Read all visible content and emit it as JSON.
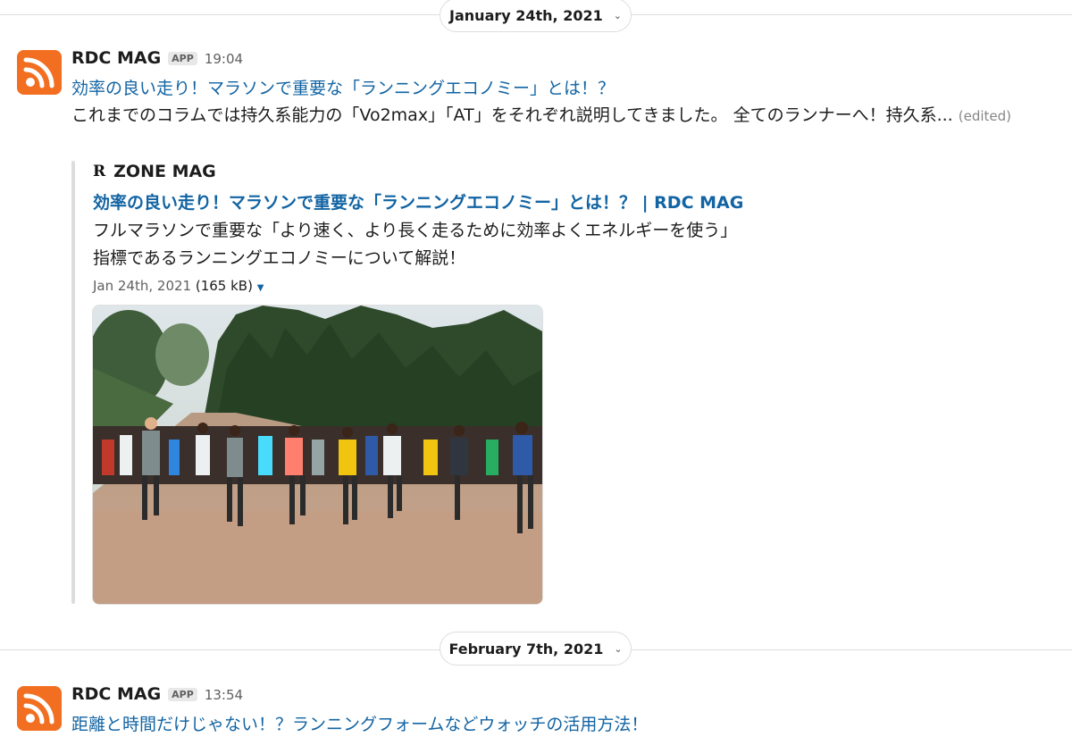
{
  "dividers": [
    {
      "date_label": "January 24th, 2021"
    },
    {
      "date_label": "February 7th, 2021"
    }
  ],
  "messages": [
    {
      "sender": "RDC MAG",
      "badge": "APP",
      "time": "19:04",
      "link": "効率の良い走り！マラソンで重要な「ランニングエコノミー」とは！？",
      "body": "これまでのコラムでは持久系能力の「Vo2max」「AT」をそれぞれ説明してきました。 全てのランナーへ！持久系...",
      "edited": "(edited)",
      "attachment": {
        "source_name": "ZONE MAG",
        "title": "効率の良い走り！マラソンで重要な「ランニングエコノミー」とは！？ | RDC MAG",
        "desc_line1": "フルマラソンで重要な「より速く、より長く走るために効率よくエネルギーを使う」",
        "desc_line2": "指標であるランニングエコノミーについて解説！",
        "date": "Jan 24th, 2021",
        "size": "(165 kB)"
      }
    },
    {
      "sender": "RDC MAG",
      "badge": "APP",
      "time": "13:54",
      "link": "距離と時間だけじゃない！？ランニングフォームなどウォッチの活用方法！"
    }
  ],
  "colors": {
    "link": "#1264a3",
    "avatar": "#f26f21",
    "text": "#1d1c1d"
  },
  "icons": {
    "avatar": "rss-icon",
    "date_chevron": "chevron-down-icon",
    "meta_caret": "caret-down-icon",
    "source_logo": "zone-mag-logo"
  }
}
